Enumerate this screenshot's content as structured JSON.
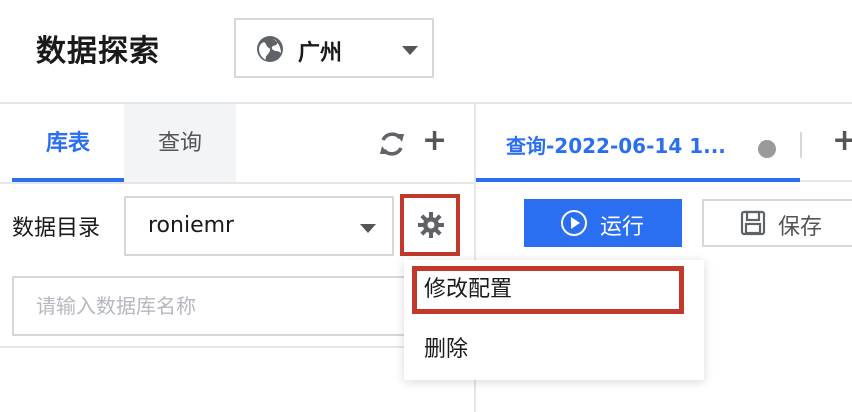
{
  "header": {
    "title": "数据探索",
    "region": {
      "label": "广州",
      "icon": "globe-icon"
    }
  },
  "left_panel": {
    "tabs": [
      {
        "label": "库表",
        "active": true
      },
      {
        "label": "查询",
        "active": false
      }
    ],
    "catalog": {
      "label": "数据目录",
      "selected": "roniemr"
    },
    "search": {
      "placeholder": "请输入数据库名称",
      "value": ""
    }
  },
  "right_panel": {
    "query_tab": {
      "title": "查询-2022-06-14 1..."
    },
    "toolbar": {
      "run_label": "运行",
      "save_label": "保存"
    }
  },
  "gear_menu": {
    "items": [
      {
        "label": "修改配置"
      },
      {
        "label": "删除"
      }
    ]
  },
  "colors": {
    "accent": "#2a6ef2",
    "highlight": "#c0392b",
    "border": "#d4d7dc"
  }
}
